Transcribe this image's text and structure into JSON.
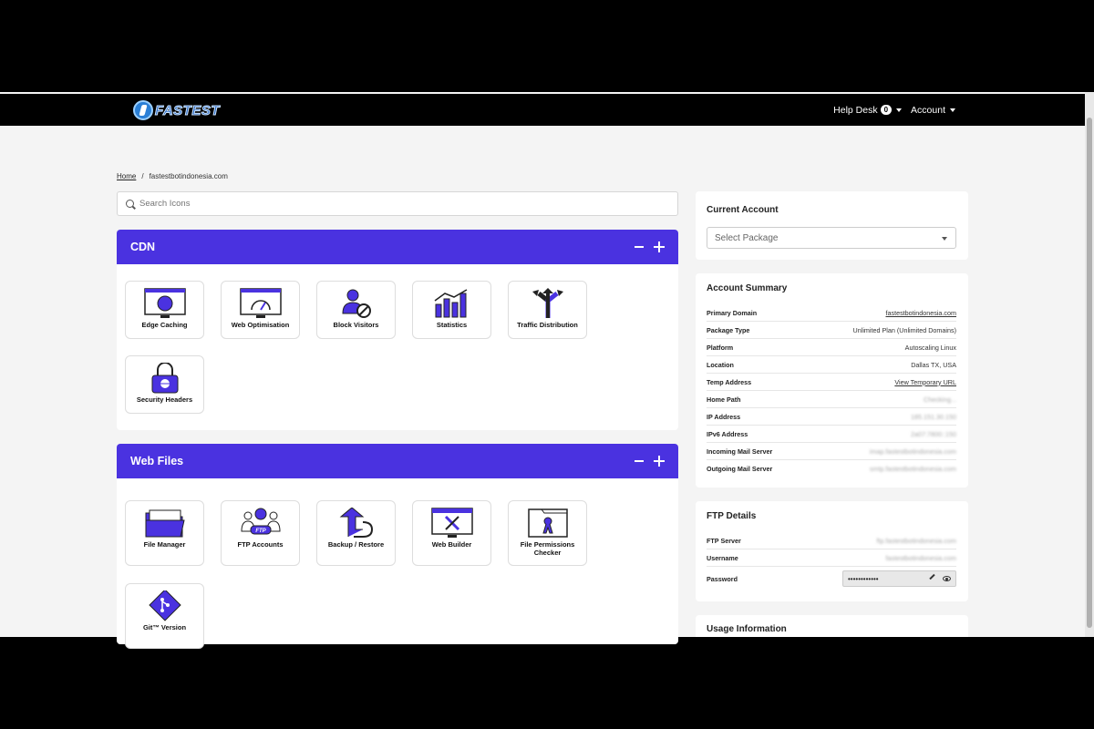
{
  "navbar": {
    "brand": "FASTEST",
    "helpdesk_label": "Help Desk",
    "helpdesk_count": "0",
    "account_label": "Account"
  },
  "breadcrumb": {
    "home": "Home",
    "current": "fastestbotindonesia.com"
  },
  "search": {
    "placeholder": "Search Icons"
  },
  "panels": {
    "cdn": {
      "title": "CDN",
      "tiles": [
        "Edge Caching",
        "Web Optimisation",
        "Block Visitors",
        "Statistics",
        "Traffic Distribution",
        "Security Headers"
      ]
    },
    "webfiles": {
      "title": "Web Files",
      "tiles": [
        "File Manager",
        "FTP Accounts",
        "Backup / Restore",
        "Web Builder",
        "File Permissions Checker",
        "Git™ Version"
      ]
    }
  },
  "current_account": {
    "title": "Current Account",
    "select_value": "Select Package"
  },
  "account_summary": {
    "title": "Account Summary",
    "rows": [
      {
        "k": "Primary Domain",
        "v": "fastestbotindonesia.com"
      },
      {
        "k": "Package Type",
        "v": "Unlimited Plan (Unlimited Domains)"
      },
      {
        "k": "Platform",
        "v": "Autoscaling Linux"
      },
      {
        "k": "Location",
        "v": "Dallas TX, USA"
      },
      {
        "k": "Temp Address",
        "v": "View Temporary URL"
      },
      {
        "k": "Home Path",
        "v": "Checking..."
      },
      {
        "k": "IP Address",
        "v": "185.151.30.150"
      },
      {
        "k": "IPv6 Address",
        "v": "2a07:7800::150"
      },
      {
        "k": "Incoming Mail Server",
        "v": "imap.fastestbotindonesia.com"
      },
      {
        "k": "Outgoing Mail Server",
        "v": "smtp.fastestbotindonesia.com"
      }
    ]
  },
  "ftp": {
    "title": "FTP Details",
    "server_k": "FTP Server",
    "server_v": "ftp.fastestbotindonesia.com",
    "user_k": "Username",
    "user_v": "fastestbotindonesia.com",
    "pass_k": "Password",
    "pass_v": "••••••••••••"
  },
  "usage": {
    "title": "Usage Information"
  },
  "colors": {
    "accent": "#4a32e0",
    "navbar": "#000000"
  }
}
